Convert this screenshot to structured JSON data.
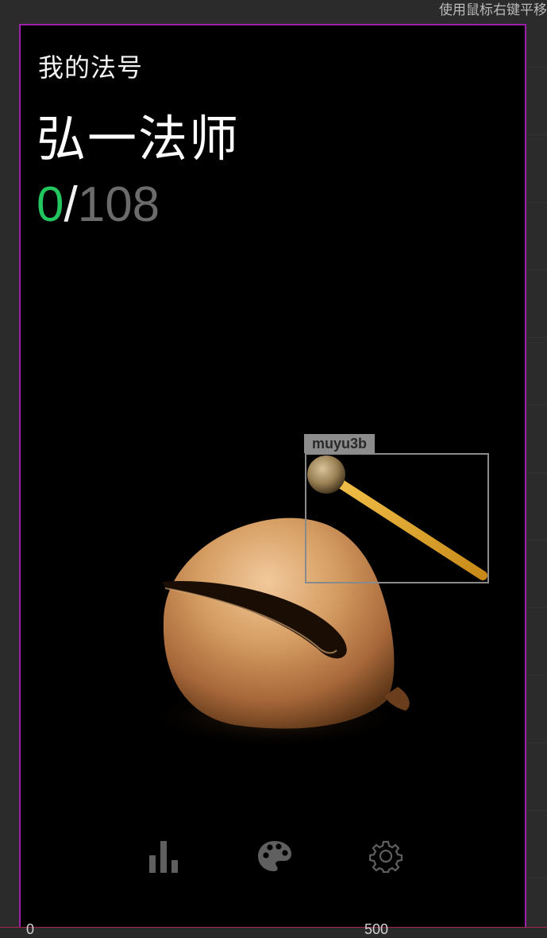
{
  "editor": {
    "top_hint": "使用鼠标右键平移",
    "selection_label": "muyu3b",
    "ruler_zero": "0",
    "ruler_mark": "500",
    "frame_color": "#9b1fa8"
  },
  "screen": {
    "subtitle": "我的法号",
    "name": "弘一法师",
    "counter": {
      "current": "0",
      "separator": "/",
      "total": "108"
    },
    "colors": {
      "current": "#22c55e",
      "total": "#6b6b6b"
    }
  },
  "toolbar": {
    "items": [
      {
        "icon": "bar-chart-icon"
      },
      {
        "icon": "palette-icon"
      },
      {
        "icon": "gear-icon"
      }
    ]
  }
}
